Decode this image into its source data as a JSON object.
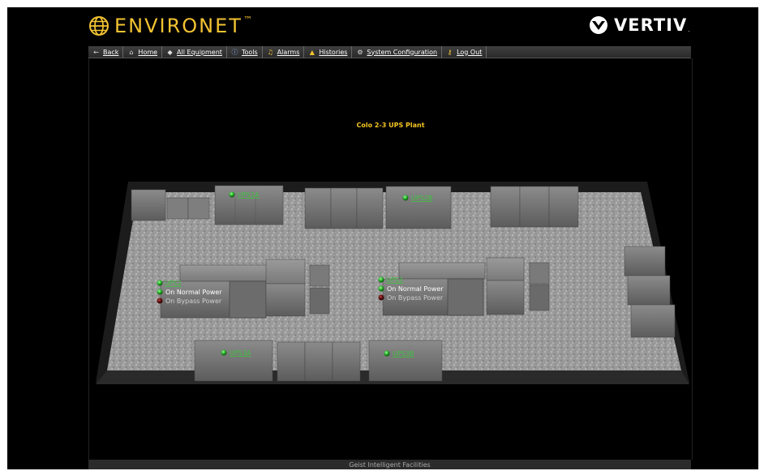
{
  "header": {
    "brand_name": "ENVIRONET",
    "brand_tm": "™",
    "vendor_name": "VERTIV",
    "vendor_dot": ".",
    "brand_color": "#f2c331"
  },
  "nav": {
    "items": [
      {
        "label": "Back",
        "icon": "arrow-left-icon"
      },
      {
        "label": "Home",
        "icon": "home-icon"
      },
      {
        "label": "All Equipment",
        "icon": "diamond-icon"
      },
      {
        "label": "Tools",
        "icon": "info-icon"
      },
      {
        "label": "Alarms",
        "icon": "bell-icon"
      },
      {
        "label": "Histories",
        "icon": "triangle-icon"
      },
      {
        "label": "System Configuration",
        "icon": "gear-icon"
      },
      {
        "label": "Log Out",
        "icon": "key-icon"
      }
    ]
  },
  "page": {
    "title": "Colo 2-3 UPS Plant"
  },
  "equipment": {
    "ups_top_left": "UPS2A",
    "ups_top_right": "UPS2B",
    "ups_bottom_left": "UPS3A",
    "ups_bottom_right": "UPS3B",
    "group_left_label": "UPS2",
    "group_left_status_1": "On Normal Power",
    "group_left_status_2": "On Bypass Power",
    "group_right_label": "UPS3",
    "group_right_status_1": "On Normal Power",
    "group_right_status_2": "On Bypass Power"
  },
  "footer": {
    "text": "Geist Intelligent Facilities"
  },
  "colors": {
    "status_ok": "#2fbf2f",
    "status_off": "#6b1010",
    "link_green": "#3ec23e",
    "title_yellow": "#f4c521"
  }
}
